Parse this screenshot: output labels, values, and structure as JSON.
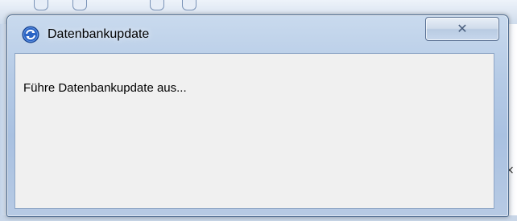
{
  "dialog": {
    "title": "Datenbankupdate",
    "message": "Führe Datenbankupdate aus...",
    "close_icon": "close-icon",
    "app_icon": "refresh-icon"
  },
  "background": {
    "visible_fragments": [
      "×",
      "t"
    ]
  },
  "colors": {
    "frame": "#b6cbe6",
    "client": "#f0f0f0",
    "icon_blue": "#2a64c5"
  }
}
